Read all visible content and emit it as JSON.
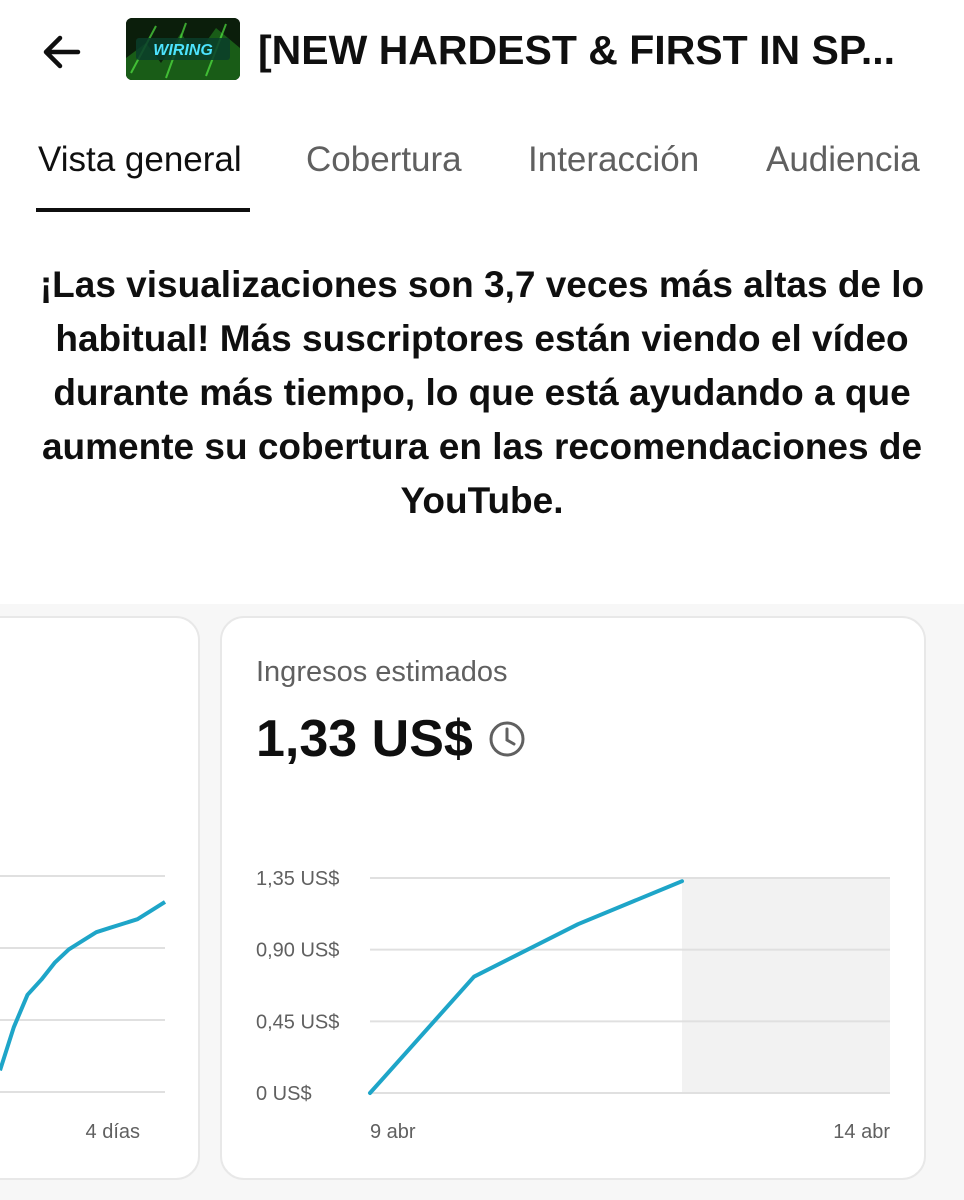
{
  "header": {
    "back_icon": "arrow-left-icon",
    "thumbnail_text": "WIRING",
    "video_title": "[NEW HARDEST & FIRST IN SP..."
  },
  "tabs": [
    {
      "label": "Vista general",
      "active": true
    },
    {
      "label": "Cobertura",
      "active": false
    },
    {
      "label": "Interacción",
      "active": false
    },
    {
      "label": "Audiencia",
      "active": false
    }
  ],
  "insight": {
    "text": "¡Las visualizaciones son 3,7 veces más altas de lo habitual! Más suscriptores están viendo el vídeo durante más tiempo, lo que está ayudando a que aumente su cobertura en las recomendaciones de YouTube."
  },
  "left_card": {
    "x_label_end": "4 días",
    "line_color": "#1ea5c8"
  },
  "revenue_card": {
    "label": "Ingresos estimados",
    "value": "1,33 US$",
    "clock_icon": "clock-icon"
  },
  "chart_data": [
    {
      "type": "line",
      "title": "",
      "x_tick_labels": [
        "4 días"
      ],
      "series": [
        {
          "values": [
            0.1,
            0.3,
            0.45,
            0.52,
            0.6,
            0.66,
            0.7,
            0.74,
            0.76,
            0.78,
            0.8,
            0.84,
            0.88
          ]
        }
      ],
      "color": "#1ea5c8"
    },
    {
      "type": "line",
      "title": "Ingresos estimados",
      "x_tick_labels": [
        "9 abr",
        "14 abr"
      ],
      "y_tick_labels": [
        "0 US$",
        "0,45 US$",
        "0,90 US$",
        "1,35 US$"
      ],
      "y_ticks": [
        0,
        0.45,
        0.9,
        1.35
      ],
      "ylim": [
        0,
        1.35
      ],
      "x_days": [
        0,
        1,
        2,
        3
      ],
      "x_domain_days": [
        0,
        5
      ],
      "series": [
        {
          "values": [
            0,
            0.73,
            1.06,
            1.33
          ]
        }
      ],
      "future_shaded_from_day": 3,
      "line_color": "#1ea5c8",
      "shade_color": "#f2f2f2",
      "grid": true
    }
  ]
}
